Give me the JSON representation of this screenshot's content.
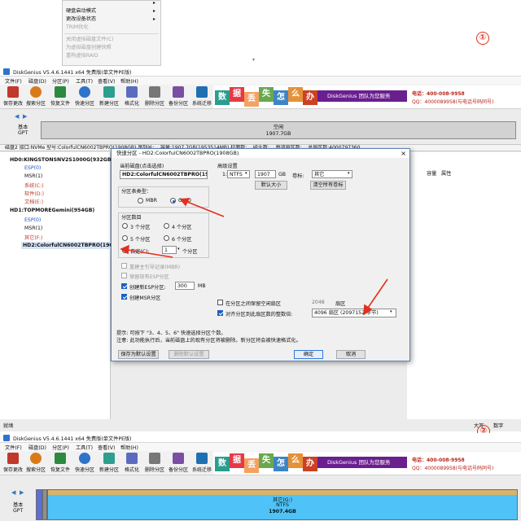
{
  "top_context_menu": {
    "items": [
      {
        "label": "",
        "disabled": false,
        "arrow": true
      },
      {
        "label": "硬盘启动模式",
        "disabled": false,
        "arrow": true
      },
      {
        "label": "更改设备状态",
        "disabled": false,
        "arrow": true
      },
      {
        "label": "TRIM优化",
        "disabled": true,
        "arrow": false
      },
      {
        "label": "关闭虚拟磁盘文件(C)",
        "disabled": true,
        "arrow": false
      },
      {
        "label": "为虚拟磁盘创建快照",
        "disabled": true,
        "arrow": false
      },
      {
        "label": "重构虚拟RAID",
        "disabled": true,
        "arrow": false
      }
    ]
  },
  "annotations": {
    "marker1": "①",
    "marker2": "②"
  },
  "app": {
    "title": "DiskGenius V5.4.6.1441 x64 免费版(单文件PE版)",
    "menu": [
      "文件(F)",
      "磁盘(D)",
      "分区(P)",
      "工具(T)",
      "查看(V)",
      "帮助(H)"
    ],
    "toolbar": [
      {
        "label": "保存更改",
        "icon": "save-icon",
        "color": "#c0392b"
      },
      {
        "label": "搜索分区",
        "icon": "magnifier-icon",
        "color": "#d97a1a"
      },
      {
        "label": "恢复文件",
        "icon": "recover-icon",
        "color": "#2b8a3e"
      },
      {
        "label": "快速分区",
        "icon": "quick-partition-icon",
        "color": "#2e74c9"
      },
      {
        "label": "新建分区",
        "icon": "new-partition-icon",
        "color": "#2e9e8f"
      },
      {
        "label": "格式化",
        "icon": "format-icon",
        "color": "#5c6bc0"
      },
      {
        "label": "删除分区",
        "icon": "trash-icon",
        "color": "#777777"
      },
      {
        "label": "备份分区",
        "icon": "backup-icon",
        "color": "#7b4ea3"
      },
      {
        "label": "系统迁移",
        "icon": "migrate-icon",
        "color": "#1f6fb3"
      }
    ],
    "banner": {
      "tiles": [
        {
          "text": "数",
          "color": "#2a9d8f"
        },
        {
          "text": "据",
          "color": "#e63946"
        },
        {
          "text": "丢",
          "color": "#f4a261"
        },
        {
          "text": "失",
          "color": "#6aa84f"
        },
        {
          "text": "怎",
          "color": "#3d85c6"
        },
        {
          "text": "么",
          "color": "#e69138"
        },
        {
          "text": "办",
          "color": "#cc4125"
        }
      ],
      "ribbon": "DiskGenius 团队为您服务",
      "phone": "电话：400-008-9958",
      "qq": "QQ：4000089958(与电话号码同号)"
    }
  },
  "disk_top": {
    "label_basic": "基本",
    "label_gpt": "GPT",
    "bar_line1": "空闲",
    "bar_line2": "1907.7GB",
    "info": "磁盘2 接口:NVMe  型号:ColorfulCN6002TBPRO(1908GB)  序列号:...  容量:1907.7GB(1953514MB)  柱面数:...  磁头数:...  每道扇区数:...  总扇区数:4000797360"
  },
  "tree": [
    {
      "label": "HD0:KINGSTONSNV2S1000G(932GB)",
      "color": "#111111",
      "bold": true
    },
    {
      "label": "ESP(0)",
      "color": "#1a56c9",
      "bold": false
    },
    {
      "label": "MSR(1)",
      "color": "#111111",
      "bold": false
    },
    {
      "label": "系统(C:)",
      "color": "#c0392b",
      "bold": false
    },
    {
      "label": "软件(D:)",
      "color": "#c0392b",
      "bold": false
    },
    {
      "label": "文档(E:)",
      "color": "#c0392b",
      "bold": false
    },
    {
      "label": "HD1:TOPMOREGemini(954GB)",
      "color": "#111111",
      "bold": true
    },
    {
      "label": "ESP(0)",
      "color": "#1a56c9",
      "bold": false
    },
    {
      "label": "MSR(1)",
      "color": "#111111",
      "bold": false
    },
    {
      "label": "其它(F:)",
      "color": "#c0392b",
      "bold": false
    },
    {
      "label": "HD2:ColorfulCN6002TBPRO(1908GB)",
      "color": "#111111",
      "bold": true
    }
  ],
  "right_header": {
    "capacity": "容量",
    "attr": "属性"
  },
  "dialog": {
    "title": "快速分区 - HD2:ColorfulCN6002TBPRO(1908GB)",
    "close": "×",
    "current_disk_label": "当前磁盘(点击选择)",
    "current_disk_value": "HD2:ColorfulCN6002TBPRO(1908GB)",
    "partition_type_label": "分区表类型：",
    "mbr": "MBR",
    "guid": "GUID",
    "partition_count_label": "分区数目",
    "counts": [
      "3 个分区",
      "4 个分区",
      "5 个分区",
      "6 个分区"
    ],
    "custom_label": "自定(C):",
    "custom_value": "1",
    "custom_unit": "个分区",
    "rebuild_mbr": "重建主引导记录(MBR)",
    "keep_esp": "保留现有ESP分区",
    "create_esp": "创建新ESP分区:",
    "esp_size": "300",
    "esp_unit": "MB",
    "create_msr": "创建MSR分区",
    "advanced_label": "高级设置",
    "adv_row": {
      "index": "1:",
      "fs": "NTFS",
      "size": "1907",
      "unit": "GB",
      "vol_label": "卷标:",
      "vol_value": "其它"
    },
    "default_size_btn": "默认大小",
    "clear_labels_btn": "清空所有卷标",
    "reserve_label": "在分区之间保留空闲扇区",
    "reserve_value": "2048",
    "reserve_unit": "扇区",
    "align_label": "对齐分区到此扇区数的整数倍:",
    "align_value": "4096 扇区 (2097152 字节)",
    "tip1": "提示: 可按下 \"3、4、5、6\" 快速选择分区个数。",
    "tip2": "注意: 此功能执行后，当前磁盘上的现有分区将被删除。新分区将会被快速格式化。",
    "save_default": "保存为默认设置",
    "delete_default": "删除默认设置",
    "ok": "确定",
    "cancel": "取消"
  },
  "status": {
    "ready": "就绪",
    "caps": "大写",
    "num": "数字"
  },
  "disk_bottom": {
    "label_basic": "基本",
    "label_gpt": "GPT",
    "bar_line1": "其它(G:)",
    "bar_line2": "NTFS",
    "bar_line3": "1907.4GB"
  }
}
